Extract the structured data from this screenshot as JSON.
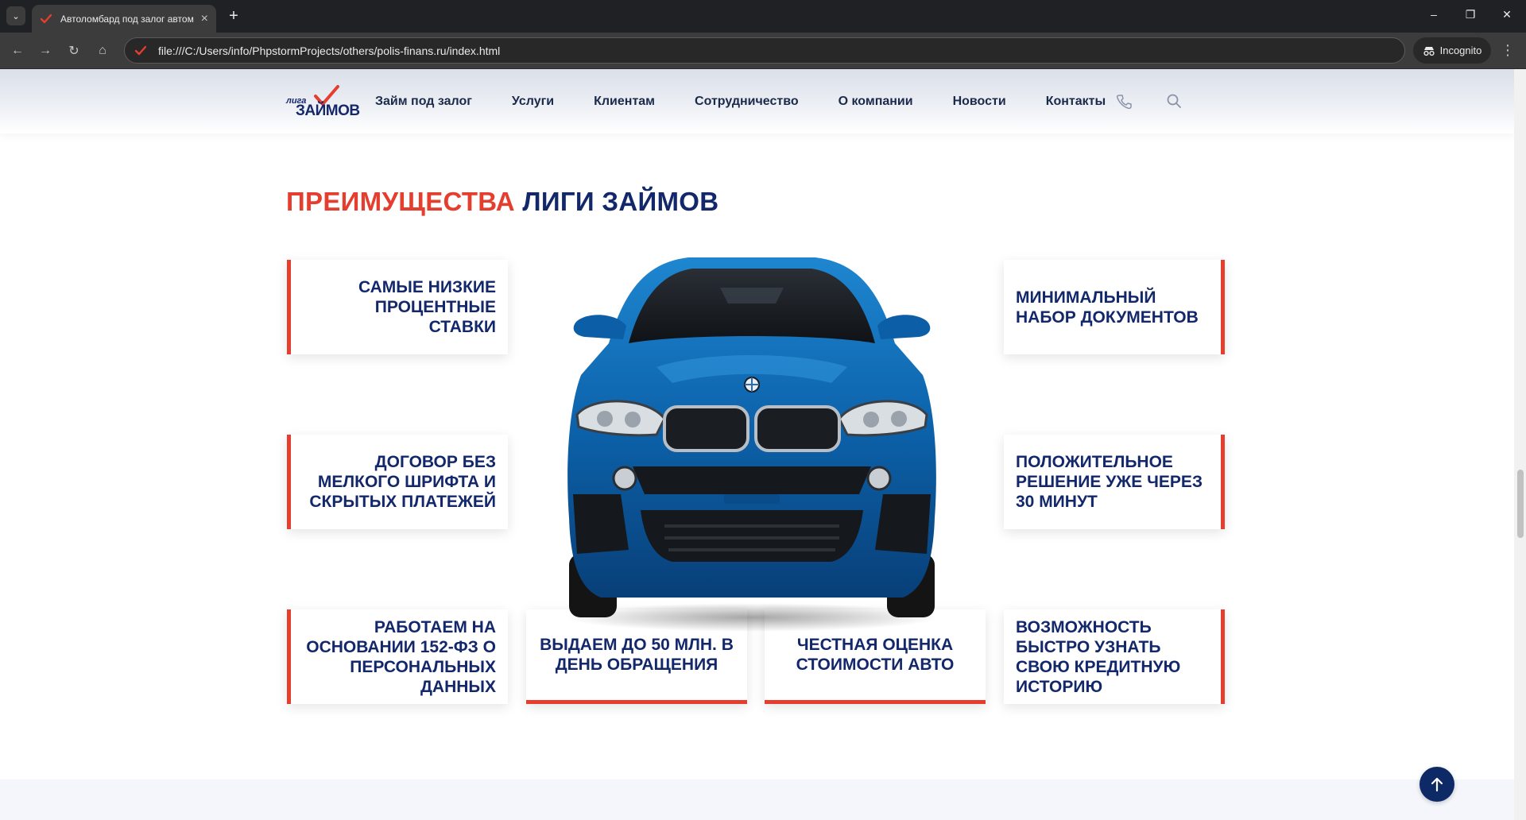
{
  "browser": {
    "tab_title": "Автоломбард под залог автом",
    "url": "file:///C:/Users/info/PhpstormProjects/others/polis-finans.ru/index.html",
    "incognito_label": "Incognito"
  },
  "site": {
    "logo_top": "лига",
    "logo_bottom": "ЗАЙМОВ",
    "menu": [
      "Займ под залог",
      "Услуги",
      "Клиентам",
      "Сотрудничество",
      "О компании",
      "Новости",
      "Контакты"
    ]
  },
  "section": {
    "title_accent": "ПРЕИМУЩЕСТВА",
    "title_main": "ЛИГИ ЗАЙМОВ",
    "cards": [
      "Самые низкие процентные ставки",
      "Минимальный набор документов",
      "Договор без мелкого шрифта и скрытых платежей",
      "Положительное решение уже через 30 минут",
      "Работаем на основании 152-ФЗ о персональных данных",
      "Выдаем до 50 млн. в день обращения",
      "Честная оценка стоимости авто",
      "Возможность быстро узнать свою кредитную историю"
    ]
  },
  "colors": {
    "accent": "#e53e2e",
    "brand": "#13286b",
    "to_top_button": "#0e2a66"
  },
  "icons": [
    "chevron-down-icon",
    "favicon-check-icon",
    "close-icon",
    "plus-icon",
    "minimize-icon",
    "restore-icon",
    "window-close-icon",
    "back-icon",
    "forward-icon",
    "reload-icon",
    "home-icon",
    "incognito-icon",
    "kebab-menu-icon",
    "phone-icon",
    "search-icon",
    "arrow-up-icon"
  ]
}
